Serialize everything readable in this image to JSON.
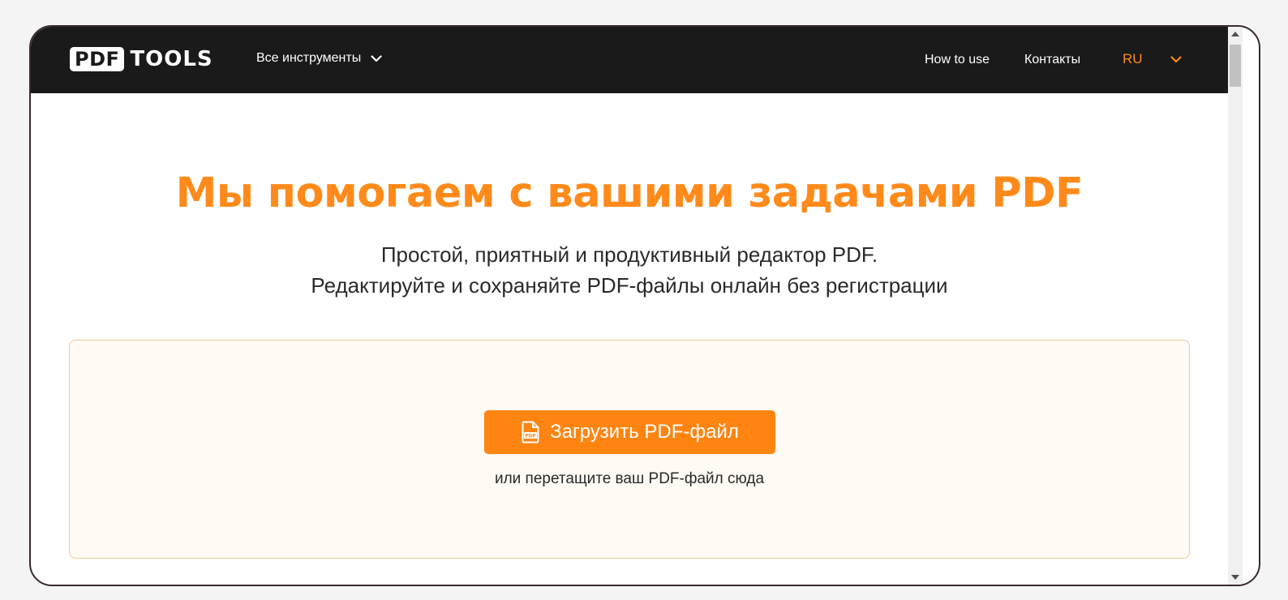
{
  "header": {
    "logo_box": "PDF",
    "logo_text": "TOOLS",
    "tools_menu_label": "Все инструменты",
    "how_to_use": "How to use",
    "contacts": "Контакты",
    "language": "RU"
  },
  "hero": {
    "title": "Мы помогаем с вашими задачами PDF",
    "subtitle_line1": "Простой, приятный и продуктивный редактор PDF.",
    "subtitle_line2": "Редактируйте и сохраняйте PDF-файлы онлайн без регистрации"
  },
  "upload": {
    "button_label": "Загрузить PDF-файл",
    "button_icon": "pdf-file-icon",
    "hint": "или перетащите ваш PDF-файл сюда"
  },
  "colors": {
    "accent": "#ff8410",
    "navbar": "#1a1a1a",
    "dropzone_bg": "#fffaf4",
    "dropzone_border": "#f3c697"
  }
}
